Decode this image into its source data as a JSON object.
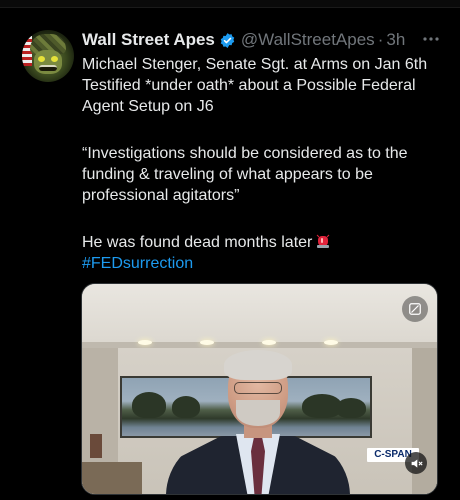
{
  "tweet": {
    "author_name": "Wall Street Apes",
    "handle": "@WallStreetApes",
    "separator": "·",
    "time": "3h",
    "more_icon": "more-dots-icon",
    "verified_icon": "verified-badge-icon",
    "paragraphs": {
      "p1": "Michael Stenger, Senate Sgt. at Arms on Jan 6th Testified *under oath* about a Possible Federal Agent Setup on J6",
      "p2": "“Investigations should be considered as to the funding & traveling of what appears to be professional agitators”",
      "p3": "He was found dead months later"
    },
    "hashtag": "#FEDsurrection",
    "emoji_icon": "police-siren-icon"
  },
  "media": {
    "type": "video",
    "broadcaster_bug": "C-SPAN",
    "gif_icon": "gif-control-icon",
    "mute_icon": "speaker-muted-icon"
  },
  "colors": {
    "background": "#000000",
    "text": "#e7e9ea",
    "secondary_text": "#71767b",
    "link": "#1d9bf0",
    "verified": "#1d9bf0"
  }
}
